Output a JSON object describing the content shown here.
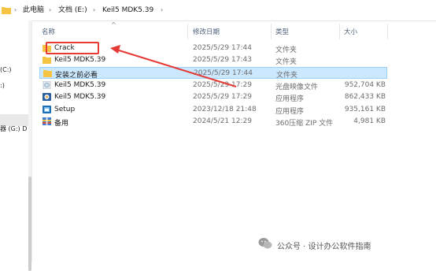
{
  "breadcrumb": {
    "items": [
      "此电脑",
      "文档 (E:)",
      "Keil5 MDK5.39"
    ]
  },
  "nav": {
    "items": [
      "(C:)",
      ":)",
      "器 (G:) D"
    ]
  },
  "columns": {
    "name": "名称",
    "date": "修改日期",
    "type": "类型",
    "size": "大小"
  },
  "files": [
    {
      "name": "Crack",
      "date": "2025/5/29 17:44",
      "type": "文件夹",
      "size": "",
      "icon": "folder-icon"
    },
    {
      "name": "Keil5 MDK5.39",
      "date": "2025/5/29 17:43",
      "type": "文件夹",
      "size": "",
      "icon": "folder-icon"
    },
    {
      "name": "安装之前必看",
      "date": "2025/5/29 17:44",
      "type": "文件夹",
      "size": "",
      "icon": "folder-icon"
    },
    {
      "name": "Keil5 MDK5.39",
      "date": "2025/5/29 17:29",
      "type": "光盘映像文件",
      "size": "952,704 KB",
      "icon": "disc-image-icon"
    },
    {
      "name": "Keil5 MDK5.39",
      "date": "2025/5/29 17:29",
      "type": "应用程序",
      "size": "862,433 KB",
      "icon": "installer-icon"
    },
    {
      "name": "Setup",
      "date": "2023/12/18 21:48",
      "type": "应用程序",
      "size": "935,161 KB",
      "icon": "setup-icon"
    },
    {
      "name": "备用",
      "date": "2024/5/21 12:29",
      "type": "360压缩 ZIP 文件",
      "size": "4,981 KB",
      "icon": "zip-icon"
    }
  ],
  "watermark": "公众号 · 设计办公软件指南",
  "colors": {
    "selection": "#cce8ff",
    "annotation": "#e53935",
    "folder": "#f6c445"
  }
}
